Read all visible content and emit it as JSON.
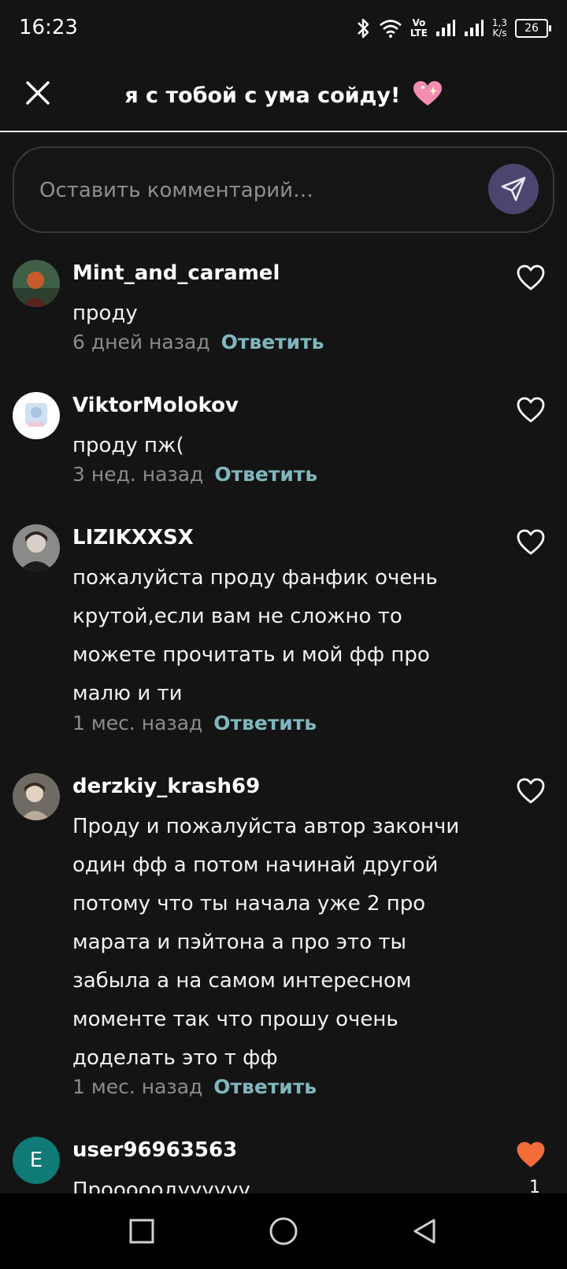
{
  "status": {
    "time": "16:23",
    "net_speed_value": "1,3",
    "net_speed_unit": "K/s",
    "battery": "26",
    "volte": "Vo",
    "lte": "LTE"
  },
  "header": {
    "title": "я с тобой с ума сойду!"
  },
  "input": {
    "placeholder": "Оставить комментарий…"
  },
  "colors": {
    "background": "#141414",
    "reply": "#7fb7bd",
    "send_button": "#4b4670",
    "liked_heart": "#f26c3a",
    "avatar_e": "#0f7a76"
  },
  "comments": [
    {
      "username": "Mint_and_caramel",
      "text": "проду",
      "time": "6 дней назад",
      "reply": "Ответить",
      "liked": false
    },
    {
      "username": "ViktorMolokov",
      "text": "проду пж(",
      "time": "3 нед. назад",
      "reply": "Ответить",
      "liked": false
    },
    {
      "username": "LIZIKXXSX",
      "text": "пожалуйста проду фанфик очень крутой,если вам не сложно то можете прочитать и мой фф про малю и ти",
      "time": "1 мес. назад",
      "reply": "Ответить",
      "liked": false
    },
    {
      "username": "derzkiy_krash69",
      "text": "Проду и пожалуйста автор закончи один фф а потом начинай другой потому что ты начала уже 2 про марата и пэйтона а про это ты забыла а на самом интересном моменте так что прошу очень доделать это т фф",
      "time": "1 мес. назад",
      "reply": "Ответить",
      "liked": false
    },
    {
      "username": "user96963563",
      "avatar_letter": "E",
      "text": "Прооооодуууууу",
      "liked": true,
      "like_count": "1"
    }
  ]
}
